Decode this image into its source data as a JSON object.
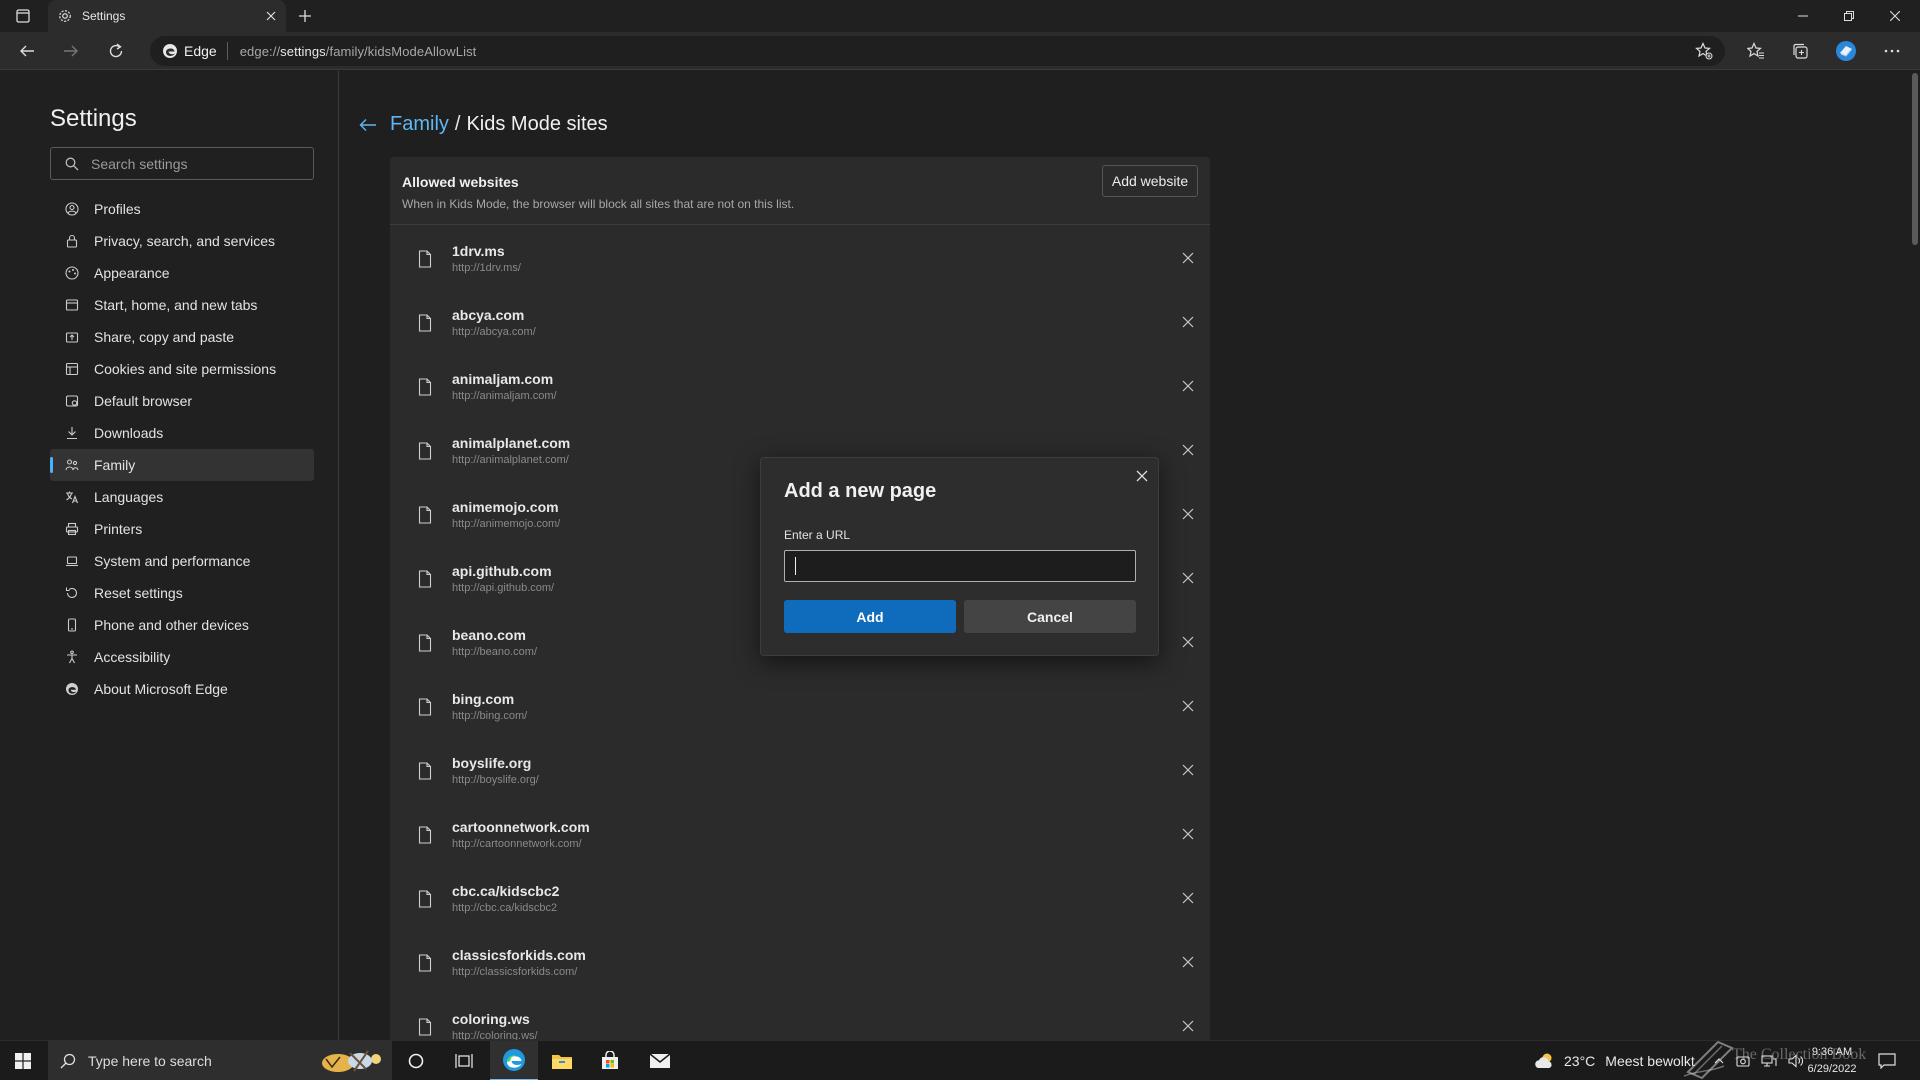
{
  "browser": {
    "tab_title": "Settings",
    "address_brand": "Edge",
    "url_prefix": "edge://",
    "url_host": "settings",
    "url_path": "/family/kidsModeAllowList"
  },
  "sidebar": {
    "title": "Settings",
    "search_placeholder": "Search settings",
    "items": [
      {
        "label": "Profiles",
        "icon": "profile-icon"
      },
      {
        "label": "Privacy, search, and services",
        "icon": "lock-icon"
      },
      {
        "label": "Appearance",
        "icon": "appearance-icon"
      },
      {
        "label": "Start, home, and new tabs",
        "icon": "home-icon"
      },
      {
        "label": "Share, copy and paste",
        "icon": "share-icon"
      },
      {
        "label": "Cookies and site permissions",
        "icon": "cookie-icon"
      },
      {
        "label": "Default browser",
        "icon": "browser-icon"
      },
      {
        "label": "Downloads",
        "icon": "download-icon"
      },
      {
        "label": "Family",
        "icon": "family-icon",
        "active": true
      },
      {
        "label": "Languages",
        "icon": "language-icon"
      },
      {
        "label": "Printers",
        "icon": "printer-icon"
      },
      {
        "label": "System and performance",
        "icon": "laptop-icon"
      },
      {
        "label": "Reset settings",
        "icon": "reset-icon"
      },
      {
        "label": "Phone and other devices",
        "icon": "phone-icon"
      },
      {
        "label": "Accessibility",
        "icon": "accessibility-icon"
      },
      {
        "label": "About Microsoft Edge",
        "icon": "edge-icon"
      }
    ]
  },
  "page": {
    "breadcrumb_parent": "Family",
    "breadcrumb_sep": "/",
    "breadcrumb_current": "Kids Mode sites",
    "allowed_title": "Allowed websites",
    "allowed_desc": "When in Kids Mode, the browser will block all sites that are not on this list.",
    "add_website_label": "Add website",
    "sites": [
      {
        "name": "1drv.ms",
        "url": "http://1drv.ms/"
      },
      {
        "name": "abcya.com",
        "url": "http://abcya.com/"
      },
      {
        "name": "animaljam.com",
        "url": "http://animaljam.com/"
      },
      {
        "name": "animalplanet.com",
        "url": "http://animalplanet.com/"
      },
      {
        "name": "animemojo.com",
        "url": "http://animemojo.com/"
      },
      {
        "name": "api.github.com",
        "url": "http://api.github.com/"
      },
      {
        "name": "beano.com",
        "url": "http://beano.com/"
      },
      {
        "name": "bing.com",
        "url": "http://bing.com/"
      },
      {
        "name": "boyslife.org",
        "url": "http://boyslife.org/"
      },
      {
        "name": "cartoonnetwork.com",
        "url": "http://cartoonnetwork.com/"
      },
      {
        "name": "cbc.ca/kidscbc2",
        "url": "http://cbc.ca/kidscbc2"
      },
      {
        "name": "classicsforkids.com",
        "url": "http://classicsforkids.com/"
      },
      {
        "name": "coloring.ws",
        "url": "http://coloring.ws/"
      }
    ]
  },
  "dialog": {
    "title": "Add a new page",
    "input_label": "Enter a URL",
    "input_value": "",
    "add_label": "Add",
    "cancel_label": "Cancel"
  },
  "taskbar": {
    "search_placeholder": "Type here to search",
    "temperature": "23°C",
    "weather_condition": "Meest bewolkt",
    "time": "9:36 AM",
    "date": "6/29/2022",
    "watermark": "The Collection Book"
  },
  "colors": {
    "accent": "#0f6cbd",
    "link": "#60b6f2",
    "background": "#1f1f1f",
    "card": "#2b2b2b"
  }
}
